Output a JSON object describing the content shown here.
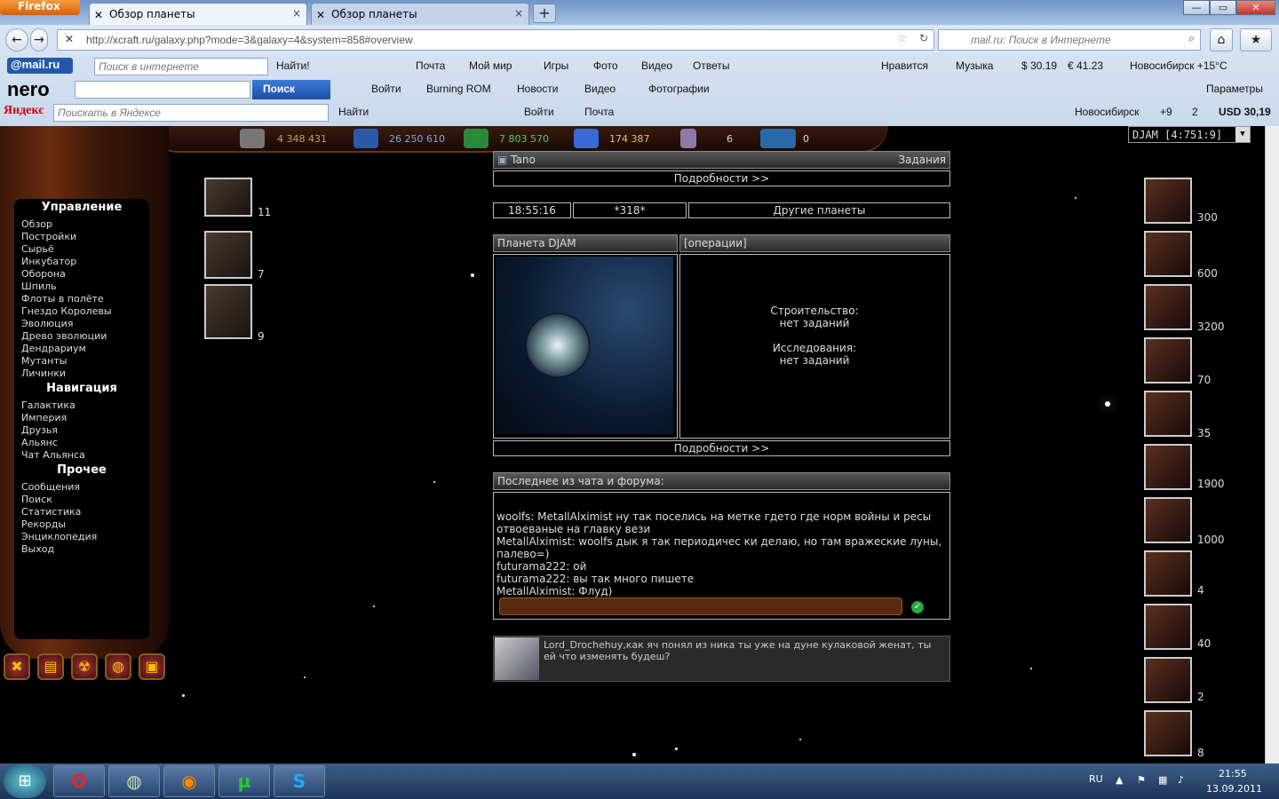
{
  "browser": {
    "app_button": "Firefox",
    "tabs": [
      {
        "label": "Обзор планеты"
      },
      {
        "label": "Обзор планеты"
      }
    ],
    "url": "http://xcraft.ru/galaxy.php?mode=3&galaxy=4&system=858#overview",
    "search_placeholder": "mail.ru: Поиск в Интернете"
  },
  "toolbar_mail": {
    "logo": "@mail.ru",
    "search_placeholder": "Поиск в интернете",
    "find": "Найти!",
    "items": [
      "Почта",
      "Мой мир",
      "Игры",
      "Фото",
      "Видео",
      "Ответы"
    ],
    "right_items": [
      "Нравится",
      "Музыка",
      "$ 30.19",
      "€ 41.23",
      "Новосибирск +15°C"
    ]
  },
  "toolbar_nero": {
    "logo": "nero",
    "search_button": "Поиск",
    "items": [
      "Войти",
      "Burning ROM",
      "Новости",
      "Видео",
      "Фотографии"
    ],
    "params": "Параметры"
  },
  "toolbar_yandex": {
    "logo": "Яндекс",
    "search_placeholder": "Поискать в Яндексе",
    "find": "Найти",
    "items": [
      "Войти",
      "Почта"
    ],
    "right_items": [
      "Новосибирск",
      "+9",
      "2",
      "USD 30,19"
    ]
  },
  "game": {
    "resources": [
      "4 348 431",
      "26 250 610",
      "7 803 570",
      "174 387",
      "6",
      "0"
    ],
    "planet_select": "DJAM [4:751:9]",
    "menu": {
      "sections": [
        {
          "title": "Управление",
          "items": [
            "Обзор",
            "Постройки",
            "Сырьё",
            "Инкубатор",
            "Оборона",
            "Шпиль",
            "Флоты в полёте",
            "Гнездо Королевы",
            "Эволюция",
            "Древо эволюции",
            "Дендрариум",
            "Мутанты",
            "Личинки"
          ]
        },
        {
          "title": "Навигация",
          "items": [
            "Галактика",
            "Империя",
            "Друзья",
            "Альянс",
            "Чат Альянса"
          ]
        },
        {
          "title": "Прочее",
          "items": [
            "Сообщения",
            "Поиск",
            "Статистика",
            "Рекорды",
            "Энциклопедия",
            "Выход"
          ]
        }
      ]
    },
    "left_units": [
      "11",
      "7",
      "9"
    ],
    "right_units": [
      "300",
      "600",
      "3200",
      "70",
      "35",
      "1900",
      "1000",
      "4",
      "40",
      "2",
      "8"
    ],
    "header": {
      "user": "Tano",
      "tasks": "Задания",
      "details": "Подробности >>"
    },
    "info": {
      "time": "18:55:16",
      "code": "*318*",
      "other_planets": "Другие планеты"
    },
    "planet": {
      "title": "Планета DJAM",
      "ops": "[операции]",
      "details": "Подробности >>"
    },
    "build": {
      "construction_label": "Строительство:",
      "construction_value": "нет заданий",
      "research_label": "Исследования:",
      "research_value": "нет заданий"
    },
    "chat": {
      "title": "Последнее из чата и форума:",
      "lines": [
        "woolfs: MetallAlximist ну так поселись на метке гдето где норм войны и ресы отвоеваные на главку вези",
        "MetallAlximist: woolfs дык я так периодичес ки делаю, но там вражеские луны, палево=)",
        "futurama222: ой",
        "futurama222: вы так много пишете",
        "MetallAlximist: Флуд)"
      ]
    },
    "message": "Lord_Drochehuy,как яч понял из ника ты уже на дуне кулаковой женат, ты ей что изменять будеш?"
  },
  "taskbar": {
    "lang": "RU",
    "time": "21:55",
    "date": "13.09.2011"
  }
}
